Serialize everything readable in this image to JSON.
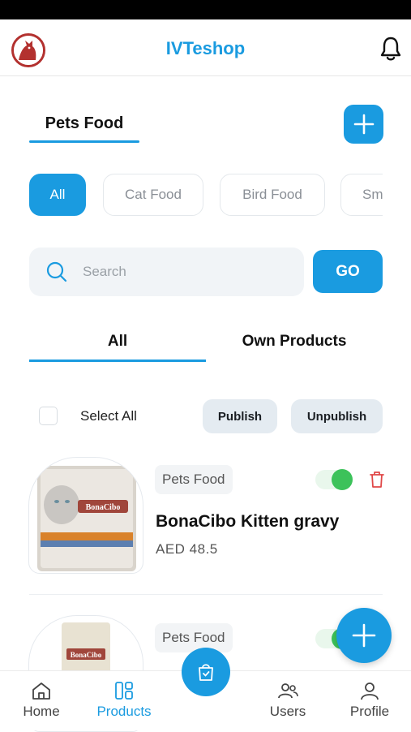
{
  "app": {
    "title": "IVTeshop"
  },
  "section": {
    "title": "Pets Food"
  },
  "categories": [
    "All",
    "Cat Food",
    "Bird Food",
    "Sm"
  ],
  "search": {
    "placeholder": "Search",
    "go_label": "GO"
  },
  "tabs": [
    "All",
    "Own Products"
  ],
  "selection": {
    "select_all_label": "Select All",
    "publish_label": "Publish",
    "unpublish_label": "Unpublish"
  },
  "products": [
    {
      "category": "Pets Food",
      "name": "BonaCibo  Kitten gravy",
      "price": "AED 48.5",
      "published": true,
      "image_brand": "BonaCibo"
    },
    {
      "category": "Pets Food",
      "name": "",
      "price": "",
      "published": true,
      "image_brand": "BonaCibo"
    }
  ],
  "bottom_nav": {
    "home": "Home",
    "products": "Products",
    "users": "Users",
    "profile": "Profile"
  },
  "colors": {
    "accent": "#1a9be0",
    "toggle_on": "#3cc25a",
    "delete": "#e04848"
  }
}
